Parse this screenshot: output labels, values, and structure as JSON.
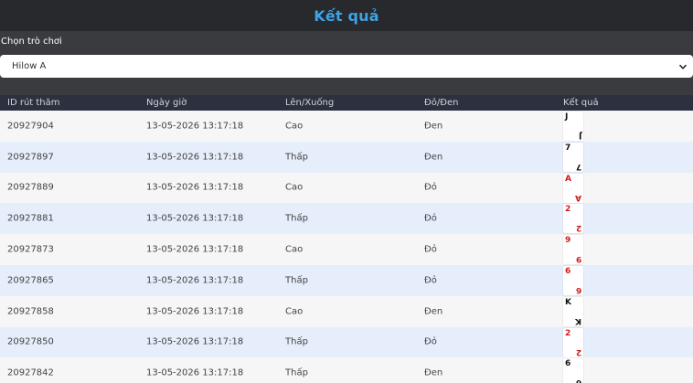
{
  "header": {
    "title": "Kết quả"
  },
  "filter": {
    "label": "Chọn trò chơi",
    "selected": "Hilow A"
  },
  "table": {
    "columns": [
      "ID rút thăm",
      "Ngày giờ",
      "Lên/Xuống",
      "Đỏ/Đen",
      "Kết quả"
    ],
    "rows": [
      {
        "id": "20927904",
        "datetime": "13-05-2026 13:17:18",
        "updown": "Cao",
        "color": "Đen",
        "card": "J",
        "suit": "black"
      },
      {
        "id": "20927897",
        "datetime": "13-05-2026 13:17:18",
        "updown": "Thấp",
        "color": "Đen",
        "card": "7",
        "suit": "black"
      },
      {
        "id": "20927889",
        "datetime": "13-05-2026 13:17:18",
        "updown": "Cao",
        "color": "Đỏ",
        "card": "A",
        "suit": "red"
      },
      {
        "id": "20927881",
        "datetime": "13-05-2026 13:17:18",
        "updown": "Thấp",
        "color": "Đỏ",
        "card": "2",
        "suit": "red"
      },
      {
        "id": "20927873",
        "datetime": "13-05-2026 13:17:18",
        "updown": "Cao",
        "color": "Đỏ",
        "card": "9",
        "suit": "red"
      },
      {
        "id": "20927865",
        "datetime": "13-05-2026 13:17:18",
        "updown": "Thấp",
        "color": "Đỏ",
        "card": "6",
        "suit": "red"
      },
      {
        "id": "20927858",
        "datetime": "13-05-2026 13:17:18",
        "updown": "Cao",
        "color": "Đen",
        "card": "K",
        "suit": "black"
      },
      {
        "id": "20927850",
        "datetime": "13-05-2026 13:17:18",
        "updown": "Thấp",
        "color": "Đỏ",
        "card": "2",
        "suit": "red"
      },
      {
        "id": "20927842",
        "datetime": "13-05-2026 13:17:18",
        "updown": "Thấp",
        "color": "Đen",
        "card": "6",
        "suit": "black"
      }
    ]
  },
  "colors": {
    "accent": "#3ca3e6",
    "header_bg": "#27292c",
    "panel_bg": "#3a3b3f",
    "thead_bg": "#2c3140",
    "row_odd": "#f6f6f6",
    "row_even": "#e6eefb",
    "red_suit": "#d21a1a"
  },
  "icons": {
    "select": "chevron-down-icon"
  }
}
